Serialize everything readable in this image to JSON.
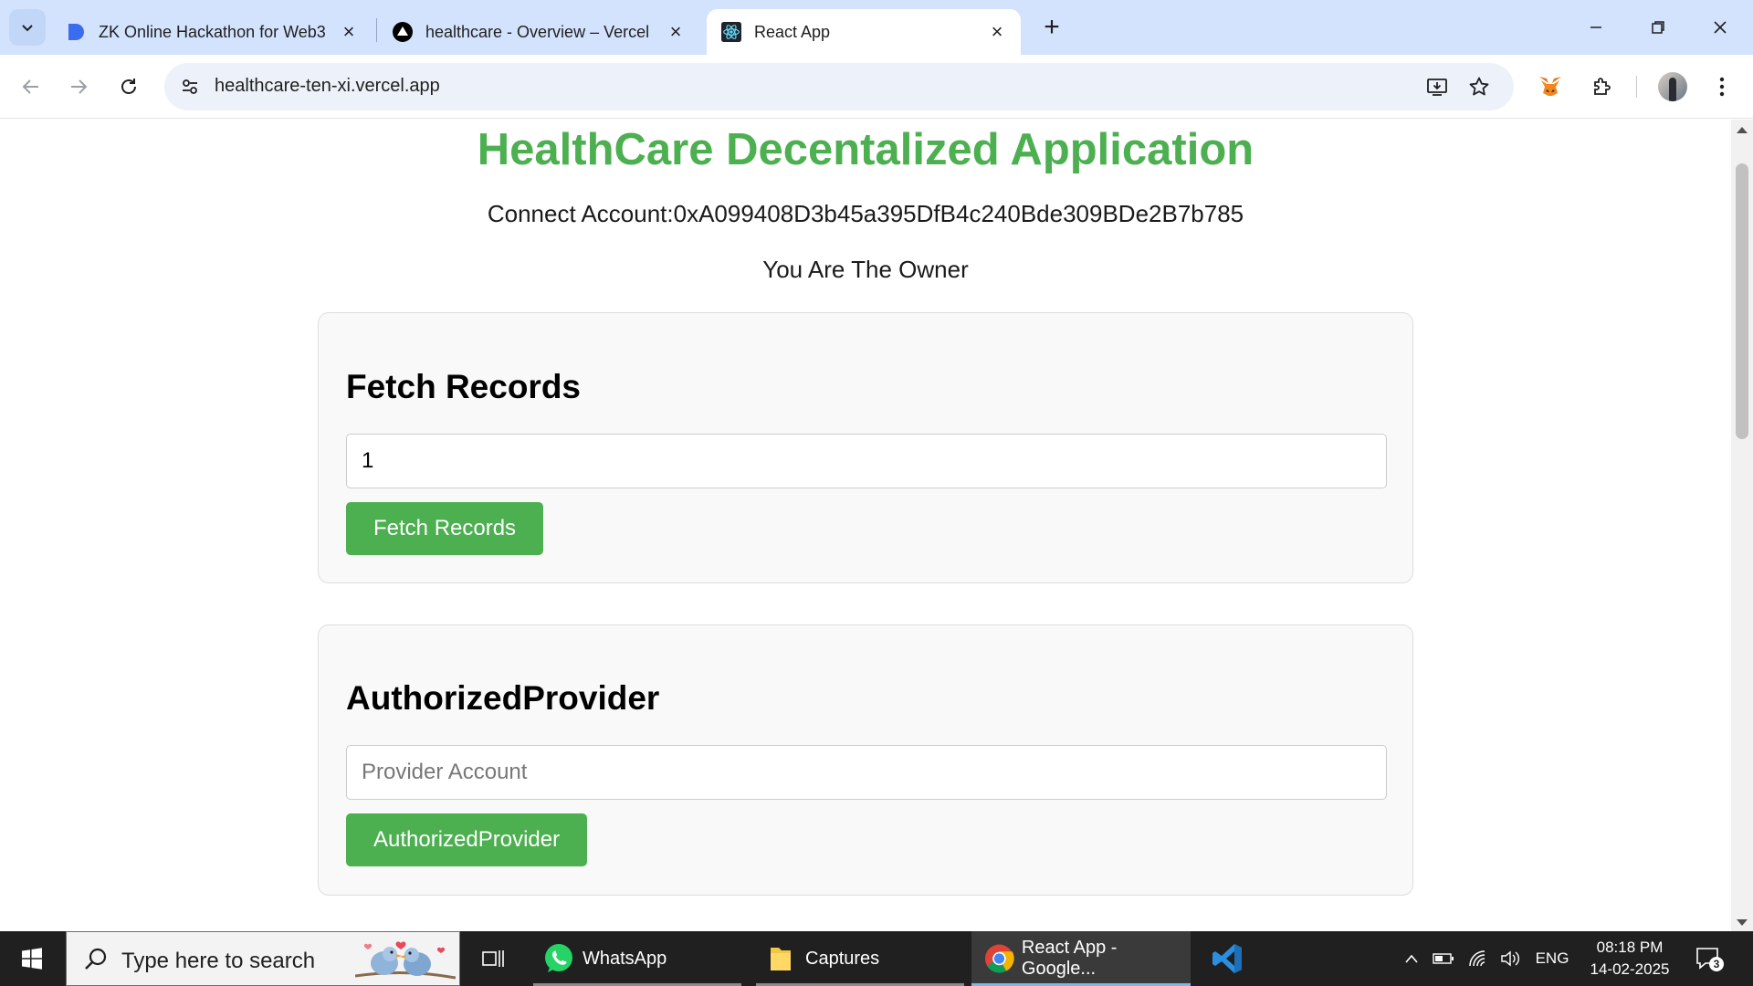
{
  "browser": {
    "tabs": [
      {
        "title": "ZK Online Hackathon for Web3",
        "favicon": "zk-hackathon-icon"
      },
      {
        "title": "healthcare - Overview – Vercel",
        "favicon": "vercel-icon"
      },
      {
        "title": "React App",
        "favicon": "react-icon",
        "active": true
      }
    ],
    "url": "healthcare-ten-xi.vercel.app"
  },
  "page": {
    "title": "HealthCare Decentalized Application",
    "account": "Connect Account:0xA099408D3b45a395DfB4c240Bde309BDe2B7b785",
    "role": "You Are The Owner",
    "fetch_records": {
      "heading": "Fetch Records",
      "input_value": "1",
      "button": "Fetch Records"
    },
    "authorized_provider": {
      "heading": "AuthorizedProvider",
      "input_placeholder": "Provider Account",
      "button": "AuthorizedProvider"
    }
  },
  "taskbar": {
    "search_placeholder": "Type here to search",
    "apps": [
      {
        "label": "WhatsApp",
        "icon": "whatsapp-icon"
      },
      {
        "label": "Captures",
        "icon": "folder-icon"
      },
      {
        "label": "React App - Google...",
        "icon": "chrome-icon",
        "active": true
      },
      {
        "label": "",
        "icon": "vscode-icon"
      }
    ],
    "language": "ENG",
    "time": "08:18 PM",
    "date": "14-02-2025",
    "notification_count": "3"
  },
  "colors": {
    "accent_green": "#4caf50",
    "tabbar": "#d3e3fd",
    "taskbar": "#202020"
  }
}
